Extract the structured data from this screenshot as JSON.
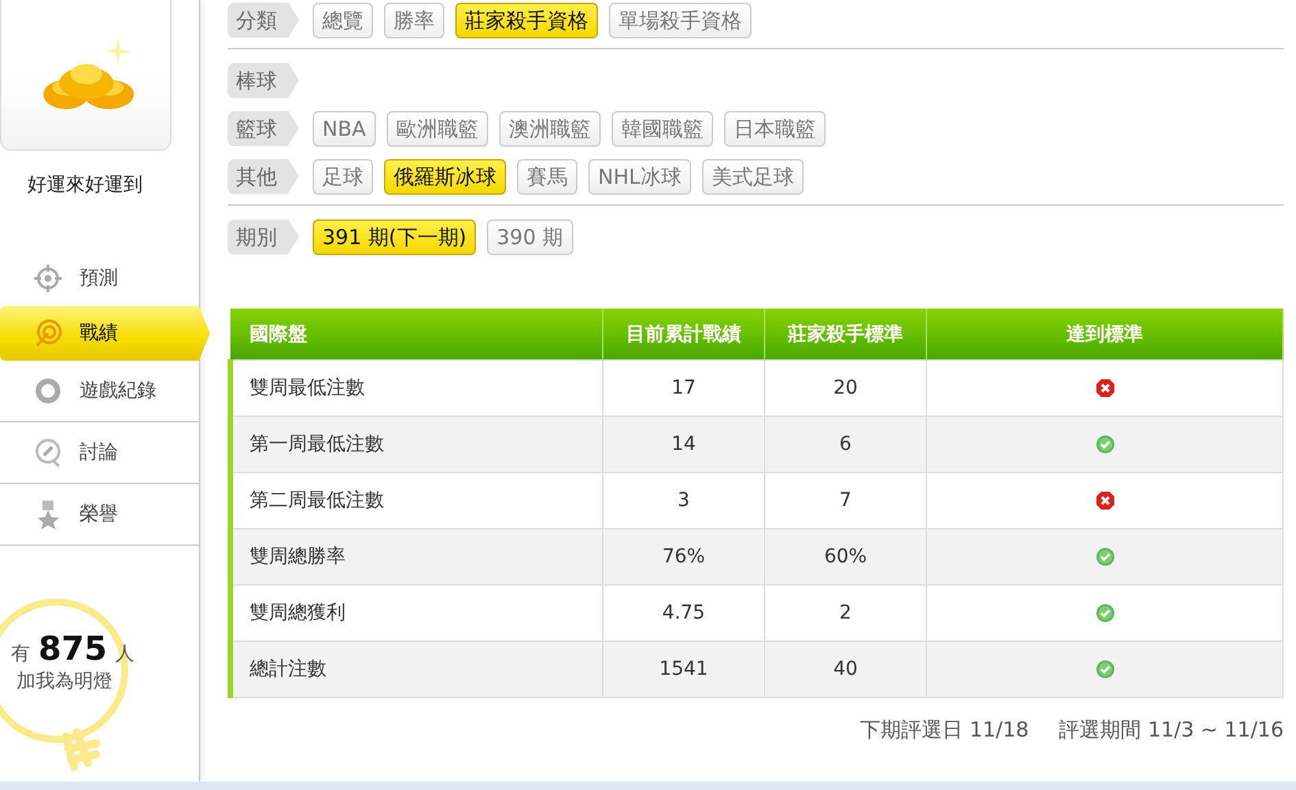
{
  "profile": {
    "name": "好運來好運到"
  },
  "nav": [
    {
      "label": "預測",
      "selected": false
    },
    {
      "label": "戰績",
      "selected": true
    },
    {
      "label": "遊戲紀錄",
      "selected": false
    },
    {
      "label": "討論",
      "selected": false
    },
    {
      "label": "榮譽",
      "selected": false
    }
  ],
  "fans": {
    "prefix": "有",
    "count": "875",
    "suffix": "人",
    "caption": "加我為明燈"
  },
  "filter_sections": [
    {
      "rows": [
        {
          "label": "分類",
          "options": [
            {
              "label": "總覽",
              "selected": false
            },
            {
              "label": "勝率",
              "selected": false
            },
            {
              "label": "莊家殺手資格",
              "selected": true
            },
            {
              "label": "單場殺手資格",
              "selected": false
            }
          ]
        }
      ]
    },
    {
      "rows": [
        {
          "label": "棒球",
          "options": []
        },
        {
          "label": "籃球",
          "options": [
            {
              "label": "NBA",
              "selected": false
            },
            {
              "label": "歐洲職籃",
              "selected": false
            },
            {
              "label": "澳洲職籃",
              "selected": false
            },
            {
              "label": "韓國職籃",
              "selected": false
            },
            {
              "label": "日本職籃",
              "selected": false
            }
          ]
        },
        {
          "label": "其他",
          "options": [
            {
              "label": "足球",
              "selected": false
            },
            {
              "label": "俄羅斯冰球",
              "selected": true
            },
            {
              "label": "賽馬",
              "selected": false
            },
            {
              "label": "NHL冰球",
              "selected": false
            },
            {
              "label": "美式足球",
              "selected": false
            }
          ]
        }
      ]
    },
    {
      "rows": [
        {
          "label": "期別",
          "options": [
            {
              "label": "391 期(下一期)",
              "selected": true
            },
            {
              "label": "390 期",
              "selected": false
            }
          ]
        }
      ]
    }
  ],
  "table": {
    "columns": [
      "國際盤",
      "目前累計戰績",
      "莊家殺手標準",
      "達到標準"
    ],
    "rows": [
      {
        "item": "雙周最低注數",
        "current": "17",
        "standard": "20",
        "met": false
      },
      {
        "item": "第一周最低注數",
        "current": "14",
        "standard": "6",
        "met": true
      },
      {
        "item": "第二周最低注數",
        "current": "3",
        "standard": "7",
        "met": false
      },
      {
        "item": "雙周總勝率",
        "current": "76%",
        "standard": "60%",
        "met": true
      },
      {
        "item": "雙周總獲利",
        "current": "4.75",
        "standard": "2",
        "met": true
      },
      {
        "item": "總計注數",
        "current": "1541",
        "standard": "40",
        "met": true
      }
    ]
  },
  "footer": {
    "next_date": "下期評選日 11/18",
    "period": "評選期間 11/3 ~ 11/16"
  }
}
